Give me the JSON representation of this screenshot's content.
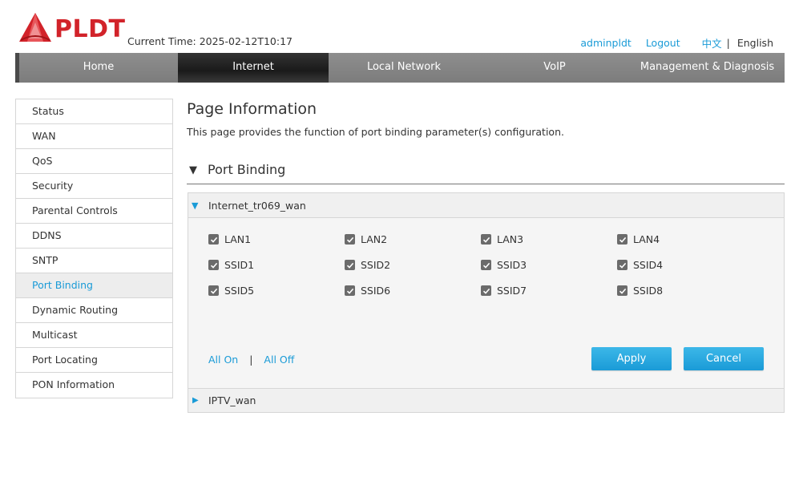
{
  "brand": {
    "name": "PLDT",
    "color": "#d2232a"
  },
  "header": {
    "current_time": "Current Time: 2025-02-12T10:17",
    "username": "adminpldt",
    "logout": "Logout",
    "lang_zh": "中文",
    "lang_sep": "|",
    "lang_en": "English"
  },
  "nav": {
    "items": [
      {
        "label": "Home"
      },
      {
        "label": "Internet",
        "active": true
      },
      {
        "label": "Local Network"
      },
      {
        "label": "VoIP"
      },
      {
        "label": "Management & Diagnosis"
      }
    ]
  },
  "sidebar": {
    "items": [
      {
        "label": "Status"
      },
      {
        "label": "WAN"
      },
      {
        "label": "QoS"
      },
      {
        "label": "Security"
      },
      {
        "label": "Parental Controls"
      },
      {
        "label": "DDNS"
      },
      {
        "label": "SNTP"
      },
      {
        "label": "Port Binding",
        "active": true
      },
      {
        "label": "Dynamic Routing"
      },
      {
        "label": "Multicast"
      },
      {
        "label": "Port Locating"
      },
      {
        "label": "PON Information"
      }
    ]
  },
  "main": {
    "title": "Page Information",
    "description": "This page provides the function of port binding parameter(s) configuration.",
    "section_title": "Port Binding",
    "wan1": {
      "name": "Internet_tr069_wan",
      "ports": [
        {
          "label": "LAN1",
          "checked": true
        },
        {
          "label": "LAN2",
          "checked": true
        },
        {
          "label": "LAN3",
          "checked": true
        },
        {
          "label": "LAN4",
          "checked": true
        },
        {
          "label": "SSID1",
          "checked": true
        },
        {
          "label": "SSID2",
          "checked": true
        },
        {
          "label": "SSID3",
          "checked": true
        },
        {
          "label": "SSID4",
          "checked": true
        },
        {
          "label": "SSID5",
          "checked": true
        },
        {
          "label": "SSID6",
          "checked": true
        },
        {
          "label": "SSID7",
          "checked": true
        },
        {
          "label": "SSID8",
          "checked": true
        }
      ],
      "all_on": "All On",
      "sep": "|",
      "all_off": "All Off",
      "apply": "Apply",
      "cancel": "Cancel"
    },
    "wan2": {
      "name": "IPTV_wan"
    }
  },
  "colors": {
    "accent": "#1a9bd7",
    "nav_bg": "#808080",
    "nav_active": "#222222"
  }
}
